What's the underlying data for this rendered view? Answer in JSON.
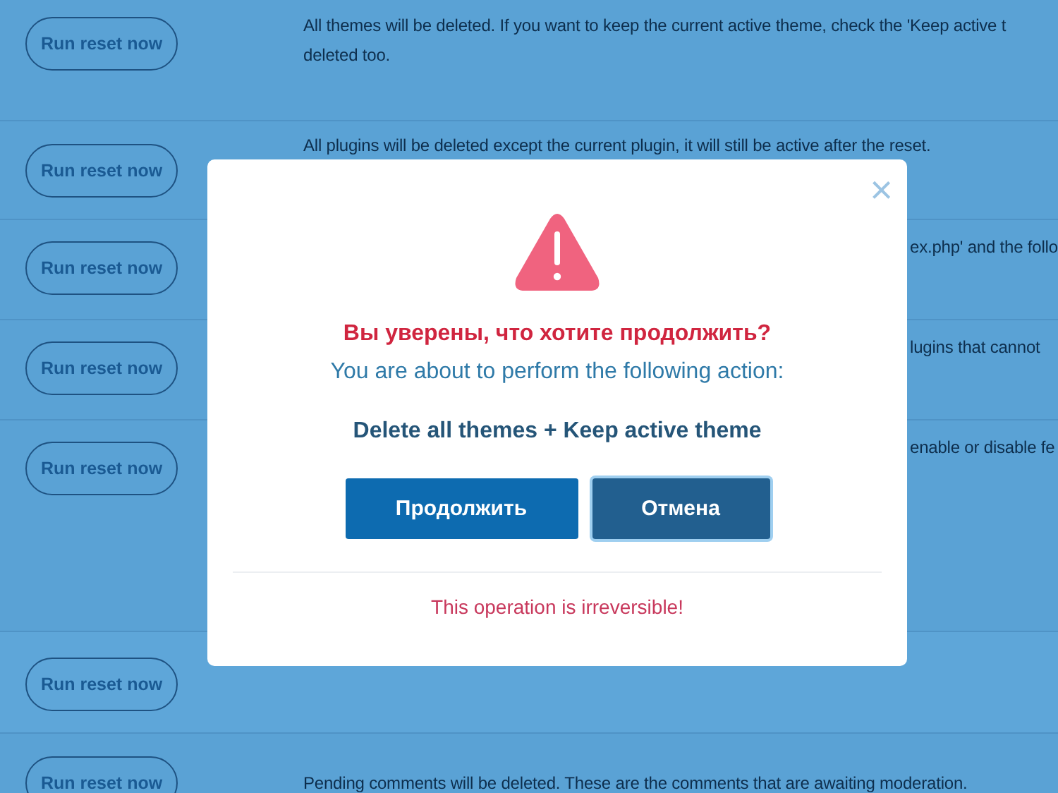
{
  "rows": [
    {
      "button": "Run reset now",
      "covered": false,
      "lines": [
        "All themes will be deleted. If you want to keep the current active theme, check the 'Keep active t",
        "deleted too."
      ]
    },
    {
      "button": "Run reset now",
      "covered": false,
      "lines": [
        "All plugins will be deleted except the current plugin, it will still be active after the reset."
      ]
    },
    {
      "button": "Run reset now",
      "covered": true,
      "lines": [
        "ex.php' and the follo"
      ]
    },
    {
      "button": "Run reset now",
      "covered": true,
      "lines": [
        "lugins that cannot"
      ]
    },
    {
      "button": "Run reset now",
      "covered": true,
      "lines": [
        "enable or disable fe"
      ]
    },
    {
      "button": "Run reset now",
      "lines": []
    },
    {
      "button": "Run reset now",
      "covered": false,
      "lines": [
        "Pending comments will be deleted. These are the comments that are awaiting moderation."
      ]
    }
  ],
  "dialog": {
    "close": "×",
    "question": "Вы уверены, что хотите продолжить?",
    "subtitle": "You are about to perform the following action:",
    "action": "Delete all themes + Keep active theme",
    "buttons": [
      {
        "label": "Продолжить",
        "kind": "confirm"
      },
      {
        "label": "Отмена",
        "kind": "cancel"
      }
    ],
    "warning": "This operation is irreversible!"
  }
}
